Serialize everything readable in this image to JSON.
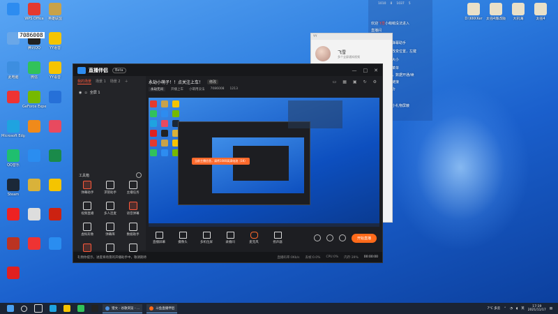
{
  "desktop": {
    "uid_badge": "7086008",
    "icons_left": [
      {
        "label": "",
        "color": "#2d8cf0"
      },
      {
        "label": "WPS Office",
        "color": "#e43a2f"
      },
      {
        "label": "英雄联盟",
        "color": "#c8a24a"
      },
      {
        "label": "",
        "color": "#6aa7e8"
      },
      {
        "label": "腾讯QQ",
        "color": "#222"
      },
      {
        "label": "YY语音",
        "color": "#f5c400"
      },
      {
        "label": "此电脑",
        "color": "#3d8ee0"
      },
      {
        "label": "微信",
        "color": "#31c25a"
      },
      {
        "label": "YY语音",
        "color": "#f5c400"
      },
      {
        "label": "",
        "color": "#e33"
      },
      {
        "label": "GeForce Experience",
        "color": "#76b900"
      },
      {
        "label": "",
        "color": "#2670d8"
      },
      {
        "label": "Microsoft Edge",
        "color": "#1fa3e0"
      },
      {
        "label": "",
        "color": "#f08a1a"
      },
      {
        "label": "",
        "color": "#e84a5f"
      },
      {
        "label": "QQ音乐",
        "color": "#1fbf6f"
      },
      {
        "label": "",
        "color": "#2a8df0"
      },
      {
        "label": "",
        "color": "#1a8a4a"
      },
      {
        "label": "Steam",
        "color": "#1b2838"
      },
      {
        "label": "",
        "color": "#d9b23a"
      },
      {
        "label": "",
        "color": "#f5c400"
      },
      {
        "label": "",
        "color": "#e22"
      },
      {
        "label": "",
        "color": "#ddd"
      },
      {
        "label": "",
        "color": "#c21"
      },
      {
        "label": "",
        "color": "#b32"
      },
      {
        "label": "",
        "color": "#e33"
      },
      {
        "label": "",
        "color": "#2a8df0"
      },
      {
        "label": "",
        "color": "#e02020"
      }
    ],
    "icons_right": [
      {
        "label": "D:\\KKKKer",
        "color": "#e9e0c8"
      },
      {
        "label": "太强4爆改版",
        "color": "#e9e0c8"
      },
      {
        "label": "大机海",
        "color": "#e9e0c8"
      },
      {
        "label": "太强4",
        "color": "#e9e0c8"
      }
    ]
  },
  "app": {
    "name": "直播伴侣",
    "version_badge": "Beta",
    "tabs": [
      "我的场景",
      "场景 1",
      "场景 2"
    ],
    "scene_item": "全屏 1",
    "toolbox_title": "工具箱",
    "tools": [
      {
        "label": "弹幕助手",
        "red": true
      },
      {
        "label": "求管助手",
        "red": false
      },
      {
        "label": "主播任务",
        "red": false
      },
      {
        "label": "视频直播",
        "red": false
      },
      {
        "label": "多人连麦",
        "red": false
      },
      {
        "label": "语音弹幕",
        "red": true
      },
      {
        "label": "虚拟形象",
        "red": false
      },
      {
        "label": "弹幕库",
        "red": false
      },
      {
        "label": "数据助手",
        "red": false
      },
      {
        "label": "",
        "red": true
      },
      {
        "label": "",
        "red": false
      },
      {
        "label": "",
        "red": false
      }
    ],
    "stream_title": "永劫小萌子！！点关注上车！",
    "modify_button": "修改",
    "category": "永劫无间",
    "info": [
      "开播上车",
      "小萌用没法",
      "7086008",
      "1213"
    ],
    "preview_toast": "当前主播信息，请将1080高清电流（1K）",
    "controls": [
      {
        "label": "直播屏幕",
        "mic": false
      },
      {
        "label": "摄像头",
        "mic": false
      },
      {
        "label": "多机位屏",
        "mic": false
      },
      {
        "label": "录播间",
        "mic": false
      },
      {
        "label": "麦克风",
        "mic": true
      },
      {
        "label": "扬声器",
        "mic": false
      }
    ],
    "start_button": "开始直播",
    "status_notice": "礼物你提示，进度将场景的开播助手中，敬请期待",
    "status_stats": [
      "直播码率:0Kb/s",
      "丢帧:0.0%",
      "CPU:0%",
      "内存:39%"
    ],
    "timer": "00:00:00"
  },
  "chat": {
    "window_title": "YY",
    "name": "飞雪",
    "subtitle": "多个全屏通知视频"
  },
  "overlay": {
    "stats": [
      "1010",
      "8",
      "1037",
      "5"
    ],
    "lines": [
      {
        "pre": "欢迎",
        "hl": "飞雪",
        "post": "小萌萌没法进入"
      },
      {
        "pre": "直播间",
        "hl": "",
        "post": ""
      },
      {
        "pre": "欢迎使用小鱼弹幕助手",
        "hl": "",
        "post": ""
      },
      {
        "pre": "左键拖拽回窗改变位置，左键",
        "hl": "",
        "post": ""
      },
      {
        "pre": "拉伸边框改变大小",
        "hl": "",
        "post": ""
      },
      {
        "pre": "右上角有设置菜单",
        "hl": "",
        "post": ""
      },
      {
        "pre": "设置展示弹幕，数据开通/续",
        "hl": "",
        "post": ""
      },
      {
        "pre": "费，粘贴弹幕链接",
        "hl": "",
        "post": ""
      },
      {
        "pre": "★已连接，成功",
        "hl": "",
        "post": ""
      },
      {
        "pre": "悟直播伴侣需小礼物屏蔽",
        "hl": "",
        "post": ""
      }
    ]
  },
  "taskbar": {
    "apps": [
      {
        "label": "猎文 - 谷歌浏览 - ...",
        "color": "#4a90e2"
      },
      {
        "label": "斗鱼直播伴侣",
        "color": "#ff6a1a"
      }
    ],
    "weather": "7°C 多云",
    "time": "17:19",
    "date": "2021/11/17",
    "lang": "英"
  }
}
